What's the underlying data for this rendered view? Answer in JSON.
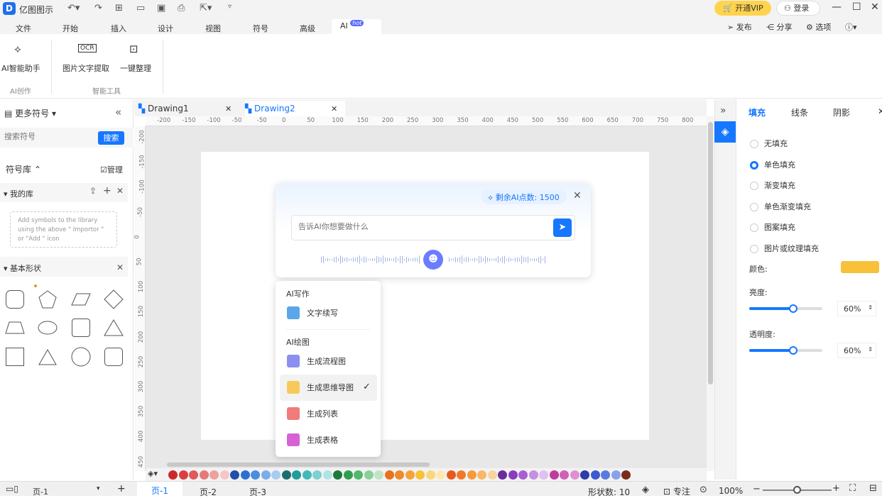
{
  "app": {
    "name": "亿图图示",
    "vip": "开通VIP",
    "login": "登录"
  },
  "menu": {
    "items": [
      "文件",
      "开始",
      "插入",
      "设计",
      "视图",
      "符号",
      "高级"
    ],
    "ai": "AI",
    "hot": "hot",
    "publish": "发布",
    "share": "分享",
    "options": "选项"
  },
  "ribbon": {
    "ai_assistant": "AI智能助手",
    "ocr": "图片文字提取",
    "organize": "一键整理",
    "group_ai": "AI创作",
    "group_tools": "智能工具",
    "ocr_icon_text": "OCR"
  },
  "left": {
    "more_symbols": "更多符号",
    "search_placeholder": "搜索符号",
    "search_btn": "搜索",
    "library": "符号库",
    "manage": "管理",
    "mylib": "我的库",
    "hint": "Add symbols to the library using the above \" Importor \" or \"Add \" icon",
    "basic": "基本形状"
  },
  "tabs": {
    "t1": "Drawing1",
    "t2": "Drawing2"
  },
  "ruler": {
    "h": [
      "-200",
      "-150",
      "-100",
      "-50",
      "-50",
      "0",
      "50",
      "100",
      "150",
      "200",
      "250",
      "300",
      "350",
      "400",
      "450",
      "500",
      "550",
      "600",
      "650",
      "700",
      "750",
      "800"
    ],
    "v": [
      "-200",
      "-150",
      "-100",
      "-50",
      "0",
      "50",
      "100",
      "150",
      "200",
      "250",
      "300",
      "350",
      "400",
      "450"
    ]
  },
  "ai_dialog": {
    "points": "剩余AI点数: 1500",
    "placeholder": "告诉AI你想要做什么"
  },
  "dropdown": {
    "sec1": "AI写作",
    "i1": "文字续写",
    "sec2": "AI绘图",
    "i2": "生成流程图",
    "i3": "生成思维导图",
    "i4": "生成列表",
    "i5": "生成表格"
  },
  "right": {
    "tab_fill": "填充",
    "tab_line": "线条",
    "tab_shadow": "阴影",
    "opts": [
      "无填充",
      "单色填充",
      "渐变填充",
      "单色渐变填充",
      "图案填充",
      "图片或纹理填充"
    ],
    "selected": 1,
    "color_label": "颜色:",
    "color": "#f8c13a",
    "brightness": "亮度:",
    "b_val": "60%",
    "b_frac": 0.6,
    "opacity": "透明度:",
    "o_val": "60%",
    "o_frac": 0.6
  },
  "palette": [
    "#cc2a2a",
    "#d94040",
    "#e05a5a",
    "#e67878",
    "#f0a0a0",
    "#f5c6c6",
    "#1f4fa8",
    "#2c6fd1",
    "#4a8ce0",
    "#7aaee8",
    "#a9cbf0",
    "#1c6e6e",
    "#1f9c9c",
    "#43b8b8",
    "#7dd0d0",
    "#b0e4e4",
    "#1e7a3a",
    "#2f9e4f",
    "#52b86b",
    "#8ad09a",
    "#bfe5c6",
    "#e8721c",
    "#f08a2c",
    "#f5a23c",
    "#f8c13a",
    "#fad77a",
    "#fde9b0",
    "#e85a1c",
    "#f07a2c",
    "#f59a3c",
    "#f8b86a",
    "#fbd3a0",
    "#6a2c9c",
    "#8a3cc0",
    "#a860d0",
    "#c690e0",
    "#e0c0f0",
    "#c03c9c",
    "#d060b8",
    "#e090d0",
    "#2c3ca8",
    "#3c5ad0",
    "#5a7ae0",
    "#8aa0ec",
    "#7a2c1c"
  ],
  "status": {
    "page": "页-1",
    "p1": "页-1",
    "p2": "页-2",
    "p3": "页-3",
    "shapes": "形状数: 10",
    "focus": "专注",
    "zoom": "100%"
  }
}
